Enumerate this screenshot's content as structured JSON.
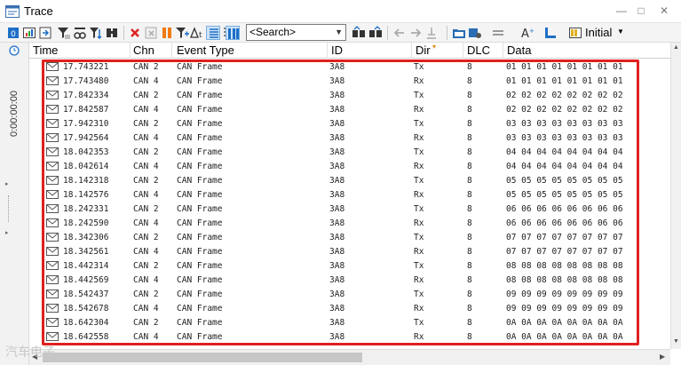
{
  "window": {
    "title": "Trace"
  },
  "toolbar": {
    "search_placeholder": "<Search>",
    "preset_label": "Initial",
    "icons": [
      "trace-config-icon",
      "chart-icon",
      "export-icon",
      "filter-icon",
      "filter-icon",
      "filter-icon",
      "find-icon",
      "clear-icon",
      "detail-view-icon",
      "pause-icon",
      "filter-plus-icon",
      "delta-time-icon",
      "fixed-position-icon",
      "sort-icon",
      "display-mode-icon",
      "search-prev-icon",
      "search-next-icon",
      "nav-back-icon",
      "nav-forward-icon",
      "mark-icon",
      "folder-icon",
      "color-icon",
      "column-icon",
      "font-icon",
      "layout-icon",
      "table-icon"
    ]
  },
  "sidebar": {
    "time_display": "0:00:00:00"
  },
  "columns": {
    "time": "Time",
    "chn": "Chn",
    "event_type": "Event Type",
    "id": "ID",
    "dir": "Dir",
    "dlc": "DLC",
    "data": "Data"
  },
  "rows": [
    {
      "time": "17.743221",
      "chn": "CAN 2",
      "event_type": "CAN Frame",
      "id": "3A8",
      "dir": "Tx",
      "dlc": "8",
      "data": "01 01 01 01 01 01 01 01"
    },
    {
      "time": "17.743480",
      "chn": "CAN 4",
      "event_type": "CAN Frame",
      "id": "3A8",
      "dir": "Rx",
      "dlc": "8",
      "data": "01 01 01 01 01 01 01 01"
    },
    {
      "time": "17.842334",
      "chn": "CAN 2",
      "event_type": "CAN Frame",
      "id": "3A8",
      "dir": "Tx",
      "dlc": "8",
      "data": "02 02 02 02 02 02 02 02"
    },
    {
      "time": "17.842587",
      "chn": "CAN 4",
      "event_type": "CAN Frame",
      "id": "3A8",
      "dir": "Rx",
      "dlc": "8",
      "data": "02 02 02 02 02 02 02 02"
    },
    {
      "time": "17.942310",
      "chn": "CAN 2",
      "event_type": "CAN Frame",
      "id": "3A8",
      "dir": "Tx",
      "dlc": "8",
      "data": "03 03 03 03 03 03 03 03"
    },
    {
      "time": "17.942564",
      "chn": "CAN 4",
      "event_type": "CAN Frame",
      "id": "3A8",
      "dir": "Rx",
      "dlc": "8",
      "data": "03 03 03 03 03 03 03 03"
    },
    {
      "time": "18.042353",
      "chn": "CAN 2",
      "event_type": "CAN Frame",
      "id": "3A8",
      "dir": "Tx",
      "dlc": "8",
      "data": "04 04 04 04 04 04 04 04"
    },
    {
      "time": "18.042614",
      "chn": "CAN 4",
      "event_type": "CAN Frame",
      "id": "3A8",
      "dir": "Rx",
      "dlc": "8",
      "data": "04 04 04 04 04 04 04 04"
    },
    {
      "time": "18.142318",
      "chn": "CAN 2",
      "event_type": "CAN Frame",
      "id": "3A8",
      "dir": "Tx",
      "dlc": "8",
      "data": "05 05 05 05 05 05 05 05"
    },
    {
      "time": "18.142576",
      "chn": "CAN 4",
      "event_type": "CAN Frame",
      "id": "3A8",
      "dir": "Rx",
      "dlc": "8",
      "data": "05 05 05 05 05 05 05 05"
    },
    {
      "time": "18.242331",
      "chn": "CAN 2",
      "event_type": "CAN Frame",
      "id": "3A8",
      "dir": "Tx",
      "dlc": "8",
      "data": "06 06 06 06 06 06 06 06"
    },
    {
      "time": "18.242590",
      "chn": "CAN 4",
      "event_type": "CAN Frame",
      "id": "3A8",
      "dir": "Rx",
      "dlc": "8",
      "data": "06 06 06 06 06 06 06 06"
    },
    {
      "time": "18.342306",
      "chn": "CAN 2",
      "event_type": "CAN Frame",
      "id": "3A8",
      "dir": "Tx",
      "dlc": "8",
      "data": "07 07 07 07 07 07 07 07"
    },
    {
      "time": "18.342561",
      "chn": "CAN 4",
      "event_type": "CAN Frame",
      "id": "3A8",
      "dir": "Rx",
      "dlc": "8",
      "data": "07 07 07 07 07 07 07 07"
    },
    {
      "time": "18.442314",
      "chn": "CAN 2",
      "event_type": "CAN Frame",
      "id": "3A8",
      "dir": "Tx",
      "dlc": "8",
      "data": "08 08 08 08 08 08 08 08"
    },
    {
      "time": "18.442569",
      "chn": "CAN 4",
      "event_type": "CAN Frame",
      "id": "3A8",
      "dir": "Rx",
      "dlc": "8",
      "data": "08 08 08 08 08 08 08 08"
    },
    {
      "time": "18.542437",
      "chn": "CAN 2",
      "event_type": "CAN Frame",
      "id": "3A8",
      "dir": "Tx",
      "dlc": "8",
      "data": "09 09 09 09 09 09 09 09"
    },
    {
      "time": "18.542678",
      "chn": "CAN 4",
      "event_type": "CAN Frame",
      "id": "3A8",
      "dir": "Rx",
      "dlc": "8",
      "data": "09 09 09 09 09 09 09 09"
    },
    {
      "time": "18.642304",
      "chn": "CAN 2",
      "event_type": "CAN Frame",
      "id": "3A8",
      "dir": "Tx",
      "dlc": "8",
      "data": "0A 0A 0A 0A 0A 0A 0A 0A"
    },
    {
      "time": "18.642558",
      "chn": "CAN 4",
      "event_type": "CAN Frame",
      "id": "3A8",
      "dir": "Rx",
      "dlc": "8",
      "data": "0A 0A 0A 0A 0A 0A 0A 0A"
    }
  ],
  "watermark": "汽车电子",
  "colors": {
    "highlight": "#e02020",
    "accent": "#1e6fc7",
    "sort_marker": "#e08a1e"
  }
}
